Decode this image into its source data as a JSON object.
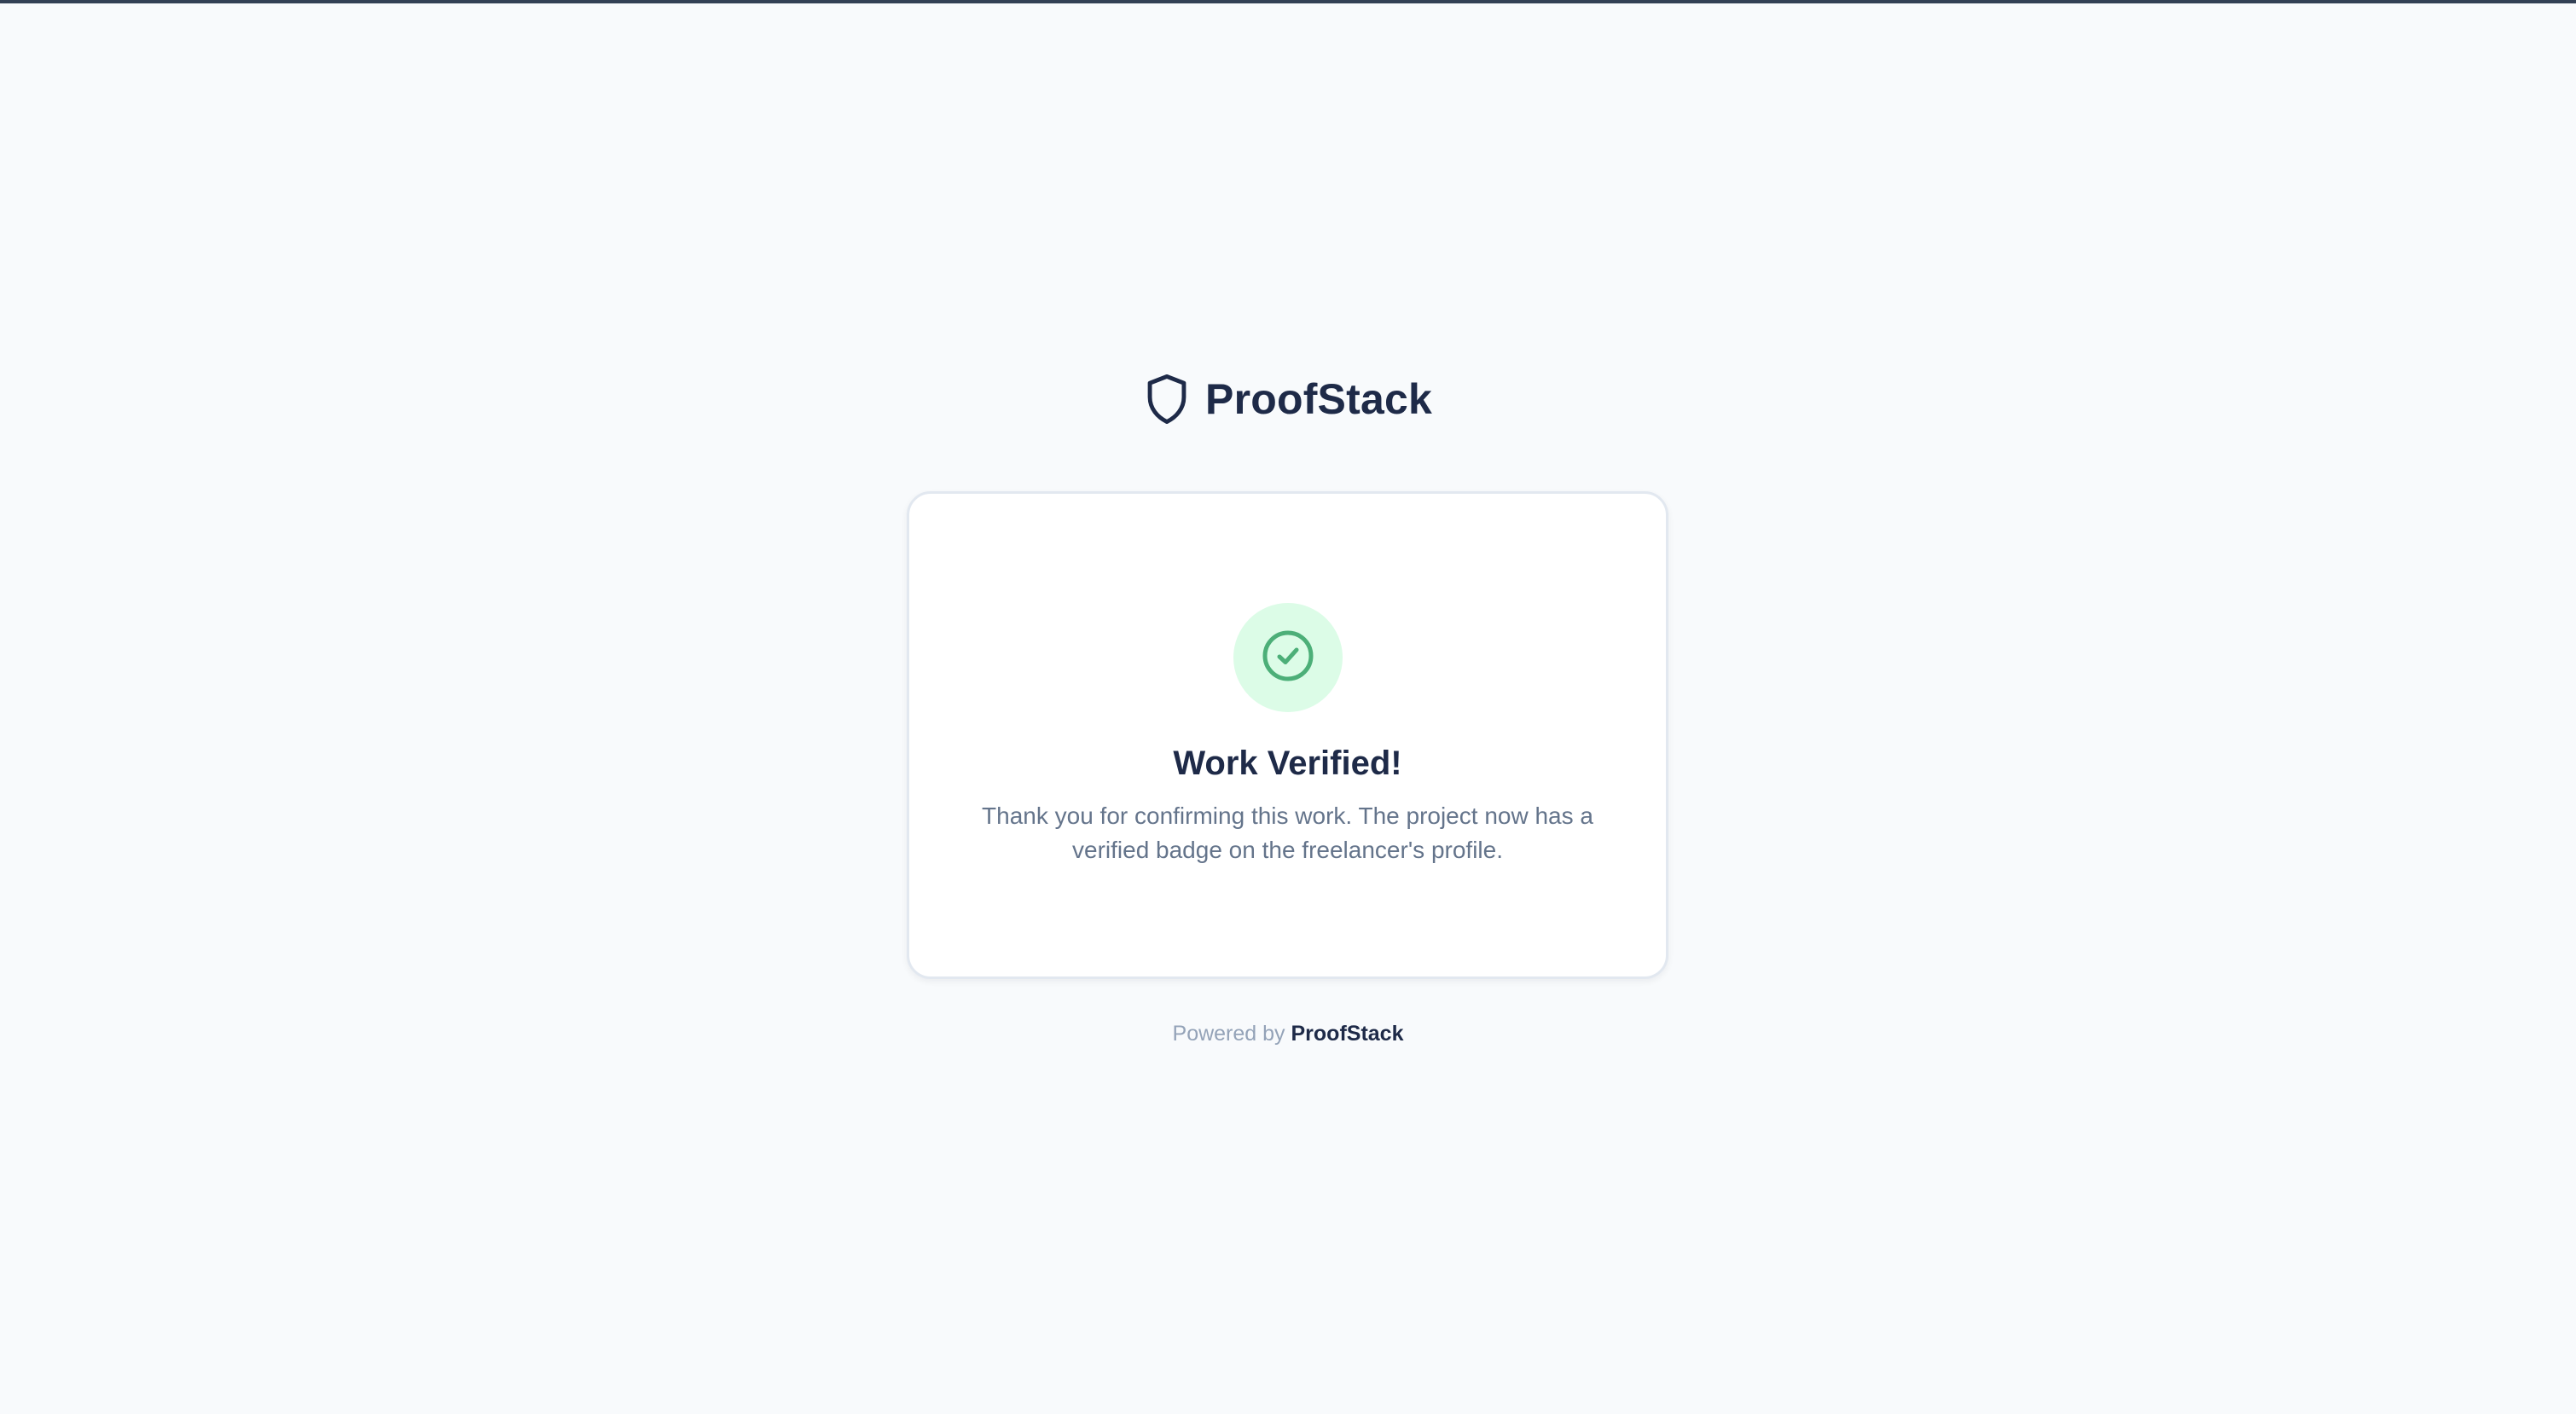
{
  "brand": {
    "name": "ProofStack",
    "icon": "shield-icon"
  },
  "card": {
    "status_icon": "check-circle-icon",
    "title": "Work Verified!",
    "message": "Thank you for confirming this work. The project now has a verified badge on the freelancer's profile."
  },
  "footer": {
    "prefix": "Powered by",
    "brand": "ProofStack"
  },
  "colors": {
    "background": "#f8fafc",
    "brand_navy": "#1e2a48",
    "success_green": "#4caf78",
    "success_bg": "#dcfce7",
    "muted_text": "#64748b"
  }
}
